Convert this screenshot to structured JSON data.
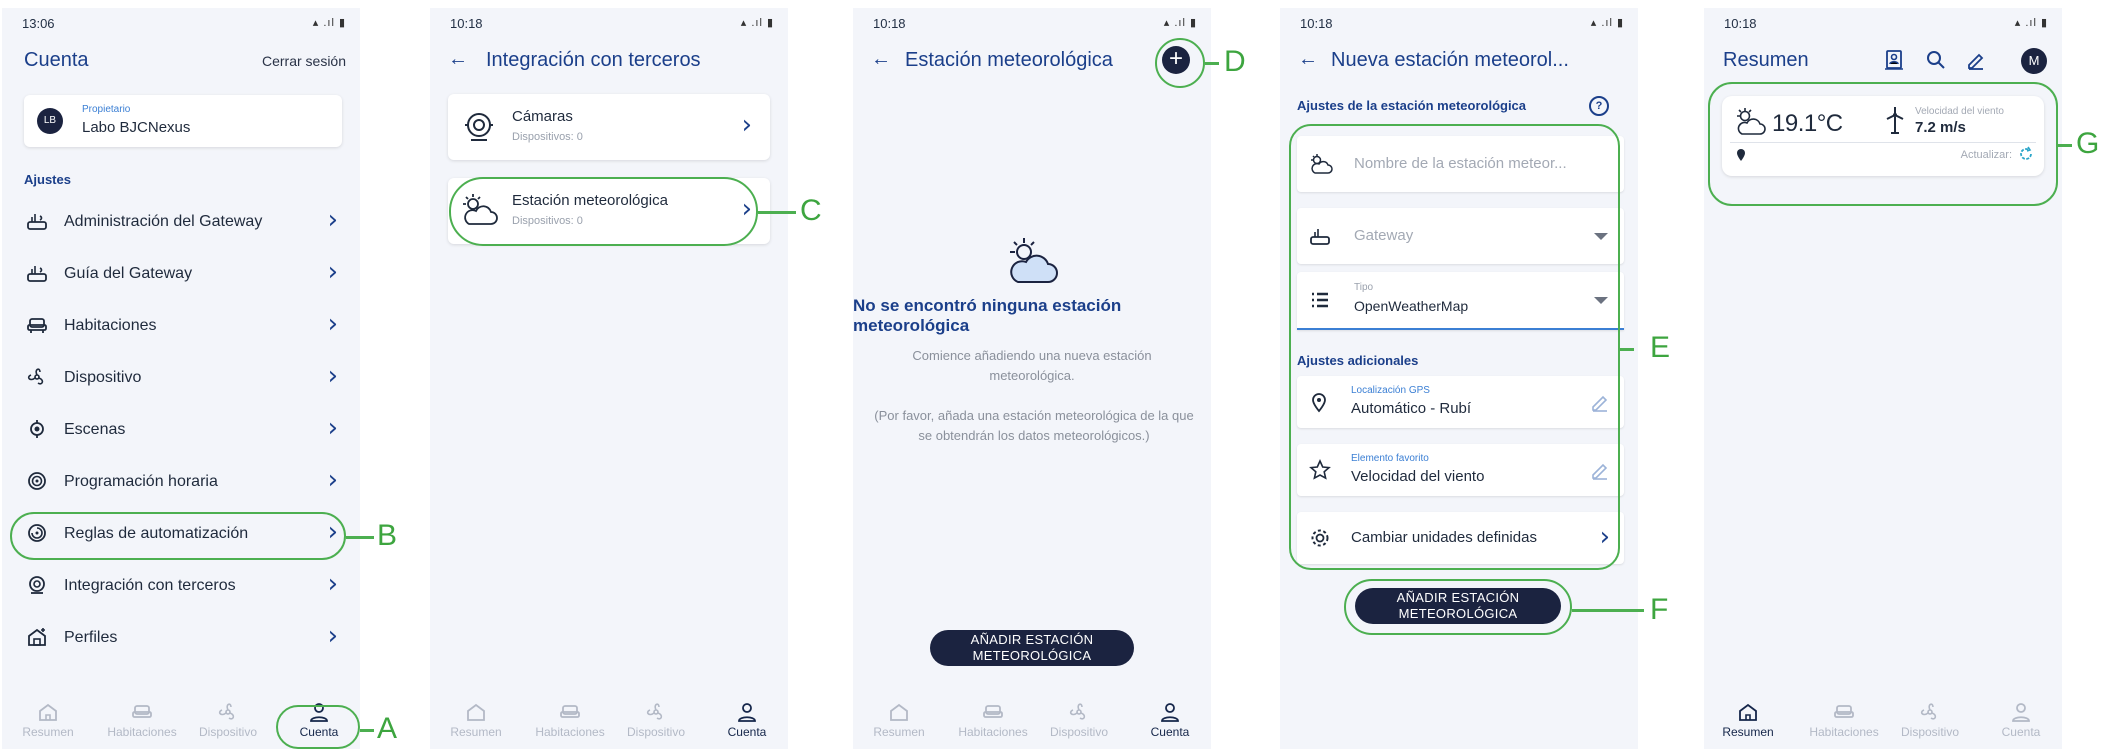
{
  "screen1": {
    "time": "13:06",
    "status_icons": "▴ .ıl ▮",
    "title": "Cuenta",
    "logout": "Cerrar sesión",
    "owner_avatar": "LB",
    "owner_role": "Propietario",
    "owner_name": "Labo BJCNexus",
    "section": "Ajustes",
    "items": [
      {
        "label": "Administración del Gateway",
        "icon": "gateway-icon"
      },
      {
        "label": "Guía del Gateway",
        "icon": "gateway-icon"
      },
      {
        "label": "Habitaciones",
        "icon": "sofa-icon"
      },
      {
        "label": "Dispositivo",
        "icon": "fan-icon"
      },
      {
        "label": "Escenas",
        "icon": "scene-icon"
      },
      {
        "label": "Programación horaria",
        "icon": "schedule-icon"
      },
      {
        "label": "Reglas de automatización",
        "icon": "automation-icon"
      },
      {
        "label": "Integración con terceros",
        "icon": "integration-icon"
      },
      {
        "label": "Perfiles",
        "icon": "profile-home-icon"
      }
    ]
  },
  "screen2": {
    "time": "10:18",
    "title": "Integración con terceros",
    "cards": [
      {
        "title": "Cámaras",
        "sub": "Dispositivos: 0",
        "icon": "camera-icon"
      },
      {
        "title": "Estación meteorológica",
        "sub": "Dispositivos: 0",
        "icon": "weather-icon"
      }
    ]
  },
  "screen3": {
    "time": "10:18",
    "title": "Estación meteorológica",
    "empty_title": "No se encontró ninguna estación meteorológica",
    "empty_line1": "Comience añadiendo una nueva estación meteorológica.",
    "empty_line2": "(Por favor, añada una estación meteorológica de la que se obtendrán los datos meteorológicos.)",
    "button": "AÑADIR ESTACIÓN METEOROLÓGICA"
  },
  "screen4": {
    "time": "10:18",
    "title": "Nueva estación meteorol...",
    "section1": "Ajustes de la estación meteorológica",
    "name_placeholder": "Nombre de la estación meteor...",
    "gateway_placeholder": "Gateway",
    "type_label": "Tipo",
    "type_value": "OpenWeatherMap",
    "section2": "Ajustes adicionales",
    "gps_label": "Localización GPS",
    "gps_value": "Automático - Rubí",
    "fav_label": "Elemento favorito",
    "fav_value": "Velocidad del viento",
    "units": "Cambiar unidades definidas",
    "button": "AÑADIR ESTACIÓN METEOROLÓGICA"
  },
  "screen5": {
    "time": "10:18",
    "title": "Resumen",
    "avatar": "M",
    "temperature": "19.1°C",
    "wind_label": "Velocidad del viento",
    "wind_value": "7.2 m/s",
    "update": "Actualizar:"
  },
  "nav": [
    "Resumen",
    "Habitaciones",
    "Dispositivo",
    "Cuenta"
  ],
  "annotations": [
    "A",
    "B",
    "C",
    "D",
    "E",
    "F",
    "G"
  ],
  "colors": {
    "accent": "#1b3f8a",
    "annotation": "#4caf50",
    "button": "#1b2340"
  }
}
